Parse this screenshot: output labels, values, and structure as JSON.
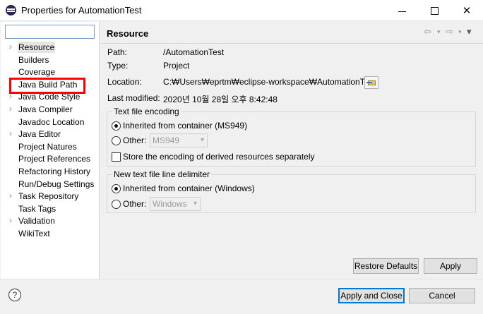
{
  "window": {
    "title": "Properties for AutomationTest",
    "minimize": "–",
    "close": "✕"
  },
  "filter": {
    "value": "",
    "placeholder": ""
  },
  "tree": {
    "items": [
      {
        "label": "Resource",
        "expandable": true
      },
      {
        "label": "Builders",
        "expandable": false
      },
      {
        "label": "Coverage",
        "expandable": false
      },
      {
        "label": "Java Build Path",
        "expandable": false
      },
      {
        "label": "Java Code Style",
        "expandable": true
      },
      {
        "label": "Java Compiler",
        "expandable": true
      },
      {
        "label": "Javadoc Location",
        "expandable": false
      },
      {
        "label": "Java Editor",
        "expandable": true
      },
      {
        "label": "Project Natures",
        "expandable": false
      },
      {
        "label": "Project References",
        "expandable": false
      },
      {
        "label": "Refactoring History",
        "expandable": false
      },
      {
        "label": "Run/Debug Settings",
        "expandable": false
      },
      {
        "label": "Task Repository",
        "expandable": true
      },
      {
        "label": "Task Tags",
        "expandable": false
      },
      {
        "label": "Validation",
        "expandable": true
      },
      {
        "label": "WikiText",
        "expandable": false
      }
    ],
    "arrow": "›"
  },
  "page": {
    "header": "Resource",
    "nav": {
      "back": "⇦",
      "dropdown": "▾",
      "forward": "⇨",
      "menu": "▾"
    },
    "path_label": "Path:",
    "path_value": "/AutomationTest",
    "type_label": "Type:",
    "type_value": "Project",
    "location_label": "Location:",
    "location_value": "C:₩Users₩eprtm₩eclipse-workspace₩AutomationTest",
    "modified_label": "Last modified:",
    "modified_value": "2020년 10월 28일 오후 8:42:48"
  },
  "encoding": {
    "group_title": "Text file encoding",
    "inherited_label": "Inherited from container (MS949)",
    "other_label": "Other:",
    "other_value": "MS949",
    "store_label": "Store the encoding of derived resources separately"
  },
  "delimiter": {
    "group_title": "New text file line delimiter",
    "inherited_label": "Inherited from container (Windows)",
    "other_label": "Other:",
    "other_value": "Windows"
  },
  "buttons": {
    "restore_defaults": "Restore Defaults",
    "apply": "Apply",
    "apply_and_close": "Apply and Close",
    "cancel": "Cancel",
    "help": "?"
  }
}
